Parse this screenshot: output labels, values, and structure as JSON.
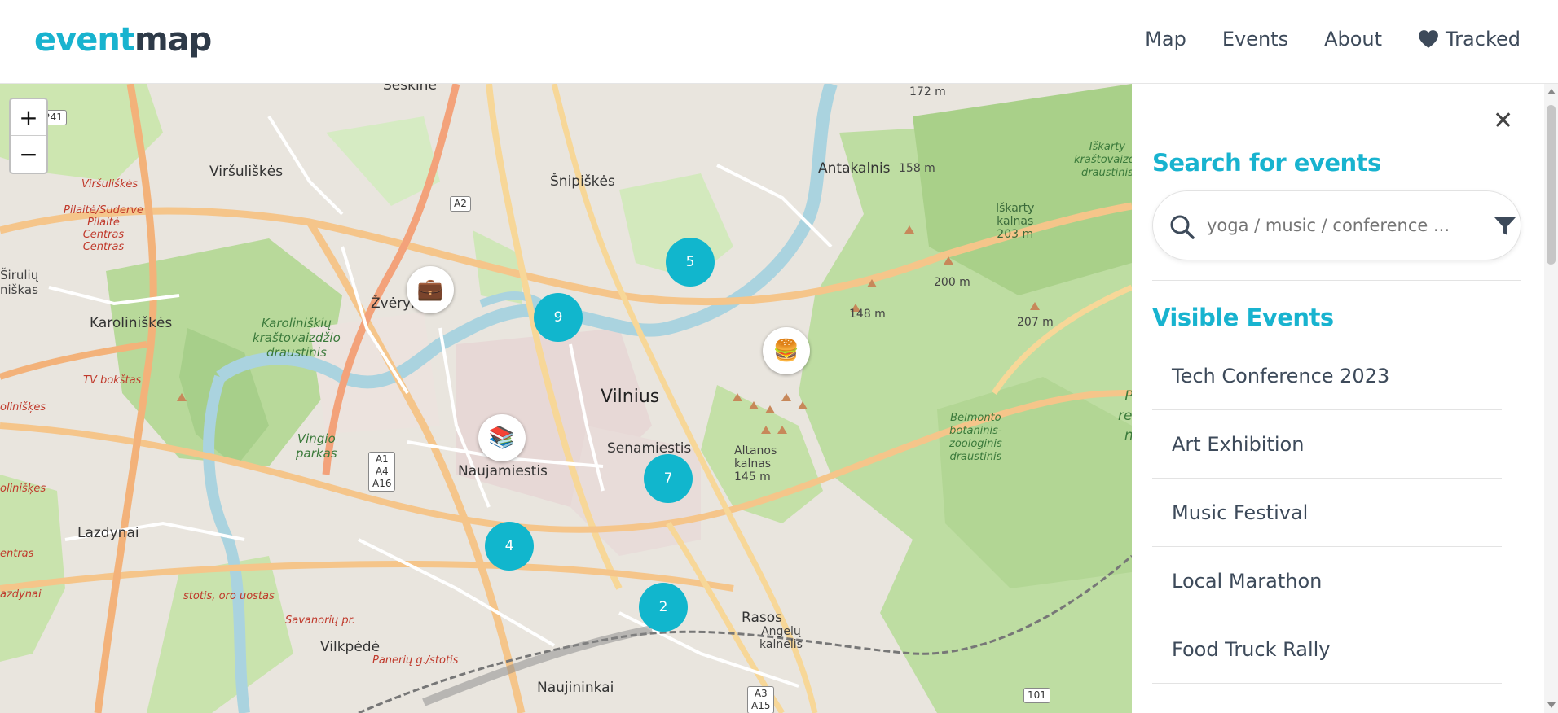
{
  "header": {
    "logo_part1": "event",
    "logo_part2": "map",
    "nav": {
      "map": "Map",
      "events": "Events",
      "about": "About",
      "tracked": "Tracked"
    }
  },
  "map": {
    "zoom_in": "+",
    "zoom_out": "−",
    "clusters": {
      "c1": "5",
      "c2": "9",
      "c3": "7",
      "c4": "4",
      "c5": "2"
    },
    "pins": {
      "briefcase": "💼",
      "burger": "🍔",
      "books": "📚"
    },
    "labels": {
      "vilnius": "Vilnius",
      "senamiestis": "Senamiestis",
      "naujamiestis": "Naujamiestis",
      "snipiskes": "Šnipiškės",
      "antakalnis": "Antakalnis",
      "zverynas": "Žvėryn",
      "karoliniskes": "Karoliniškės",
      "virsuliskes": "Viršuliškės",
      "lazdynai": "Lazdynai",
      "vilkpede": "Vilkpėdė",
      "naujininkai": "Naujininkai",
      "rasos": "Rasos",
      "seskine": "Šeškinė",
      "altanos": "Altanos\nkalnas\n145 m",
      "angelu": "Angelų\nkalnelis",
      "karoliniskiu_park": "Karoliniškių\nkraštovaizdžio\ndraustinis",
      "vingio": "Vingio\nparkas",
      "iskarty": "Iškarty\nkalnas\n203 m",
      "iskarty_dr": "Iškarty\nkraštovaizdž\ndraustinis",
      "belmonto": "Belmonto\nbotaninis-\nzoologinis\ndraustinis",
      "tv": "TV bokštas",
      "pilaite": "Pilaitė/Suderve\nPilaitė\nCentras\nCentras",
      "virsuliskes_red": "Viršuliškės",
      "stotis": "stotis, oro uostas",
      "paneriu": "Panerių g./stotis",
      "savanoriu": "Savanorių pr.",
      "m172": "172 m",
      "m158": "158 m",
      "m200": "200 m",
      "m148": "148 m",
      "m207": "207 m",
      "sirulu": "Širulių\nniškas",
      "olinaiskes": "olinišķes",
      "olinaiskes2": "olinišķes",
      "entras": "entras",
      "azdynai": "azdynai",
      "re": "P\nrec\nn"
    },
    "shields": {
      "a2": "A2",
      "a1": "A1\nA4\nA16",
      "a3": "A3\nA15",
      "s241": "241",
      "s101": "101"
    }
  },
  "sidebar": {
    "close": "✕",
    "search_heading": "Search for events",
    "search_placeholder": "yoga / music / conference ...",
    "visible_heading": "Visible Events",
    "events": [
      "Tech Conference 2023",
      "Art Exhibition",
      "Music Festival",
      "Local Marathon",
      "Food Truck Rally"
    ]
  },
  "colors": {
    "accent": "#18b3cf",
    "cluster": "#11b6cd",
    "text": "#3d4a5a"
  }
}
